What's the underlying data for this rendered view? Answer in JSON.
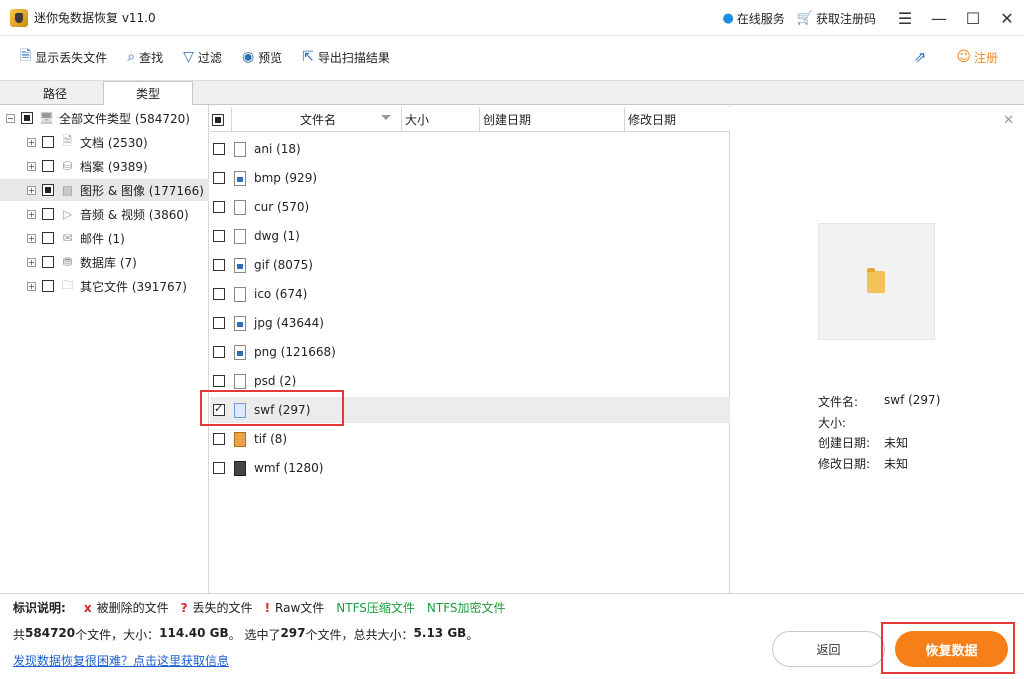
{
  "window": {
    "title": "迷你兔数据恢复 v11.0",
    "online_service": "在线服务",
    "get_code": "获取注册码"
  },
  "toolbar": {
    "show_lost": "显示丢失文件",
    "find": "查找",
    "filter": "过滤",
    "preview": "预览",
    "export": "导出扫描结果",
    "register": "注册"
  },
  "tabs": {
    "path": "路径",
    "type": "类型"
  },
  "tree": [
    {
      "label": "全部文件类型 (584720)"
    },
    {
      "label": "文档 (2530)"
    },
    {
      "label": "档案 (9389)"
    },
    {
      "label": "图形 & 图像 (177166)"
    },
    {
      "label": "音频 & 视频 (3860)"
    },
    {
      "label": "邮件 (1)"
    },
    {
      "label": "数据库 (7)"
    },
    {
      "label": "其它文件 (391767)"
    }
  ],
  "list": {
    "headers": {
      "name": "文件名",
      "size": "大小",
      "created": "创建日期",
      "modified": "修改日期"
    },
    "rows": [
      {
        "label": "ani (18)"
      },
      {
        "label": "bmp (929)"
      },
      {
        "label": "cur (570)"
      },
      {
        "label": "dwg (1)"
      },
      {
        "label": "gif (8075)"
      },
      {
        "label": "ico (674)"
      },
      {
        "label": "jpg (43644)"
      },
      {
        "label": "png (121668)"
      },
      {
        "label": "psd (2)"
      },
      {
        "label": "swf (297)"
      },
      {
        "label": "tif (8)"
      },
      {
        "label": "wmf (1280)"
      }
    ]
  },
  "preview": {
    "filename_label": "文件名:",
    "filename_value": "swf (297)",
    "size_label": "大小:",
    "size_value": "",
    "created_label": "创建日期:",
    "created_value": "未知",
    "modified_label": "修改日期:",
    "modified_value": "未知"
  },
  "legend": {
    "title": "标识说明:",
    "deleted_mark": "x",
    "deleted": "被删除的文件",
    "lost_mark": "?",
    "lost": "丢失的文件",
    "raw_mark": "!",
    "raw": "Raw文件",
    "ntfs_compressed": "NTFS压缩文件",
    "ntfs_encrypted": "NTFS加密文件"
  },
  "stats": {
    "p1": "共",
    "total_files": "584720",
    "p2": "个文件，大小：",
    "total_size": "114.40 GB",
    "p3": "。 选中了",
    "selected_files": "297",
    "p4": "个文件，总共大小：",
    "selected_size": "5.13 GB",
    "p5": "。"
  },
  "help_link": "发现数据恢复很困难？点击这里获取信息",
  "buttons": {
    "back": "返回",
    "recover": "恢复数据"
  },
  "colors": {
    "accent_orange": "#f77f17",
    "highlight_red": "#e53935",
    "toolbar_blue": "#2d6fb8",
    "ntfs_green": "#1a9e3c"
  }
}
